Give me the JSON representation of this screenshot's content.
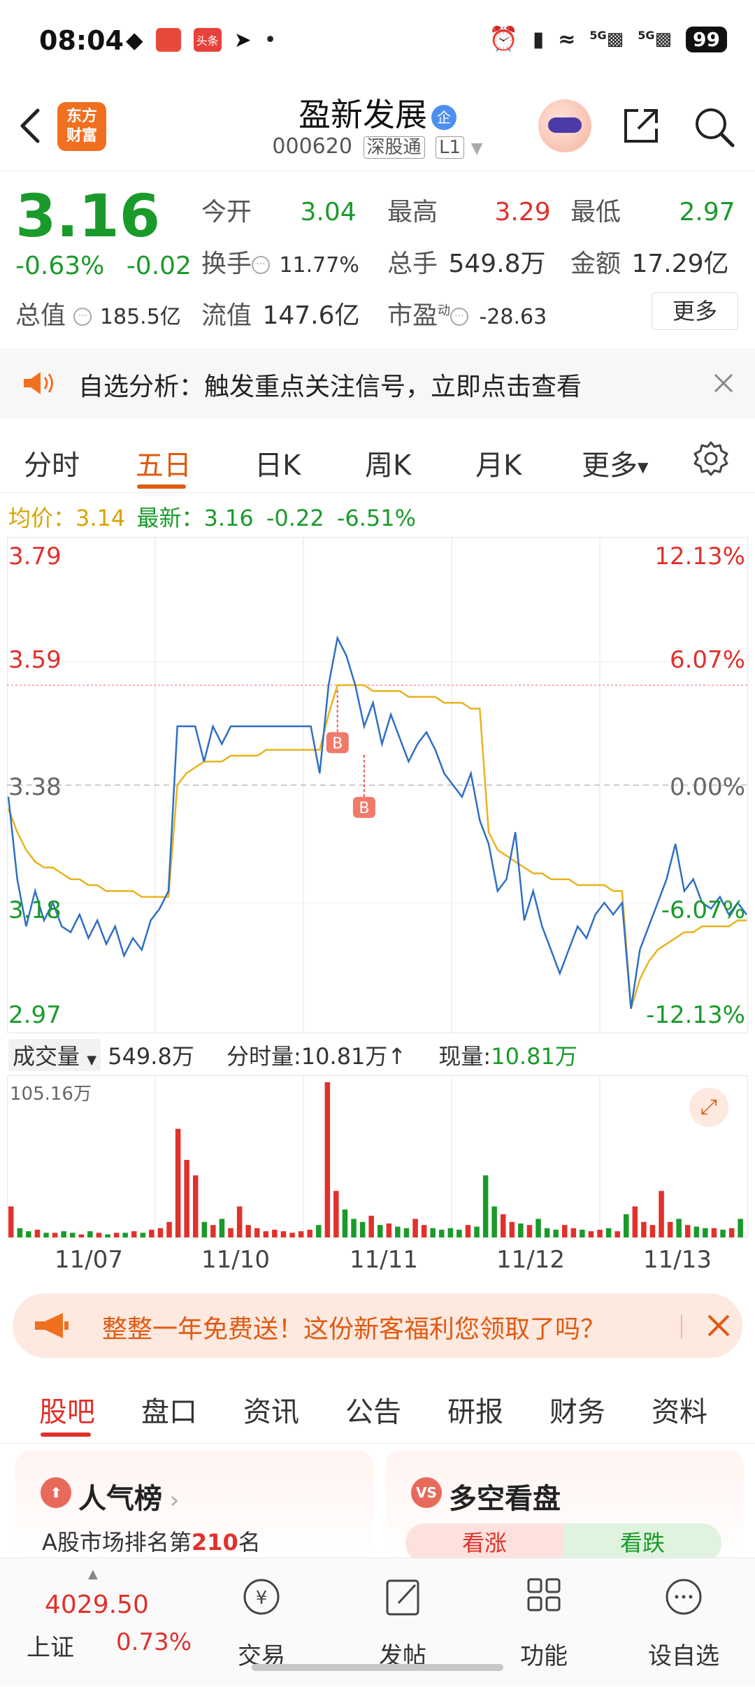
{
  "status_bar": {
    "time": "08:04",
    "battery": "99",
    "network_left": "5G",
    "network_right": "5G",
    "left_chips": [
      "wechat-icon",
      "app-icon",
      "头条",
      "paper-plane-icon",
      "•"
    ]
  },
  "header": {
    "stock_name": "盈新发展",
    "reg_badge": "企",
    "stock_code": "000620",
    "tag_connect": "深股通",
    "tag_level": "L1",
    "logo_line1": "东方",
    "logo_line2": "财富"
  },
  "quote": {
    "price": "3.16",
    "change_pct": "-0.63%",
    "change_abs": "-0.02",
    "market_cap_label": "总值",
    "market_cap": "185.5亿",
    "open_label": "今开",
    "open": "3.04",
    "high_label": "最高",
    "high": "3.29",
    "low_label": "最低",
    "low": "2.97",
    "turnover_label": "换手",
    "turnover": "11.77%",
    "volume_label": "总手",
    "volume": "549.8万",
    "amount_label": "金额",
    "amount": "17.29亿",
    "float_cap_label": "流值",
    "float_cap": "147.6亿",
    "pe_label": "市盈",
    "pe_super": "动",
    "pe": "-28.63",
    "more_label": "更多"
  },
  "alert": {
    "text": "自选分析：触发重点关注信号，立即点击查看"
  },
  "chart_tabs": {
    "items": [
      "分时",
      "五日",
      "日K",
      "周K",
      "月K",
      "更多"
    ],
    "active": "五日"
  },
  "avg_line": {
    "avg_label": "均价：",
    "avg_value": "3.14",
    "latest_label": "最新：",
    "latest_value": "3.16",
    "latest_chg": "-0.22",
    "latest_pct": "-6.51%"
  },
  "chart_data": {
    "type": "line",
    "title": "",
    "ylim": [
      2.97,
      3.79
    ],
    "y_ticks_left": [
      "3.79",
      "3.59",
      "3.38",
      "3.18",
      "2.97"
    ],
    "y_ticks_right": [
      "12.13%",
      "6.07%",
      "0.00%",
      "-6.07%",
      "-12.13%"
    ],
    "prev_close": 3.38,
    "days": [
      "11/07",
      "11/10",
      "11/11",
      "11/12",
      "11/13"
    ],
    "series": [
      {
        "name": "",
        "color": "#2f6fc4",
        "values": [
          3.36,
          3.22,
          3.14,
          3.2,
          3.15,
          3.18,
          3.14,
          3.13,
          3.16,
          3.12,
          3.15,
          3.11,
          3.14,
          3.09,
          3.12,
          3.1,
          3.15,
          3.17,
          3.2,
          3.48,
          3.48,
          3.48,
          3.42,
          3.48,
          3.45,
          3.48,
          3.48,
          3.48,
          3.48,
          3.48,
          3.48,
          3.48,
          3.48,
          3.48,
          3.48,
          3.4,
          3.55,
          3.63,
          3.6,
          3.55,
          3.48,
          3.52,
          3.45,
          3.5,
          3.46,
          3.42,
          3.45,
          3.47,
          3.44,
          3.4,
          3.38,
          3.36,
          3.4,
          3.32,
          3.28,
          3.2,
          3.22,
          3.3,
          3.15,
          3.2,
          3.14,
          3.1,
          3.06,
          3.1,
          3.14,
          3.12,
          3.16,
          3.18,
          3.16,
          3.18,
          3.0,
          3.1,
          3.14,
          3.18,
          3.22,
          3.28,
          3.2,
          3.22,
          3.18,
          3.17,
          3.19,
          3.16,
          3.18,
          3.16
        ]
      },
      {
        "name": "",
        "color": "#e7b31e",
        "values": [
          3.34,
          3.3,
          3.27,
          3.25,
          3.24,
          3.24,
          3.23,
          3.22,
          3.22,
          3.21,
          3.21,
          3.2,
          3.2,
          3.2,
          3.2,
          3.19,
          3.19,
          3.19,
          3.19,
          3.38,
          3.4,
          3.41,
          3.42,
          3.42,
          3.42,
          3.43,
          3.43,
          3.43,
          3.43,
          3.44,
          3.44,
          3.44,
          3.44,
          3.44,
          3.44,
          3.44,
          3.5,
          3.55,
          3.55,
          3.55,
          3.55,
          3.54,
          3.54,
          3.54,
          3.54,
          3.53,
          3.53,
          3.53,
          3.53,
          3.52,
          3.52,
          3.52,
          3.51,
          3.51,
          3.3,
          3.27,
          3.26,
          3.25,
          3.24,
          3.23,
          3.23,
          3.22,
          3.22,
          3.22,
          3.21,
          3.21,
          3.21,
          3.21,
          3.2,
          3.2,
          3.0,
          3.05,
          3.08,
          3.1,
          3.11,
          3.12,
          3.13,
          3.13,
          3.14,
          3.14,
          3.14,
          3.14,
          3.15,
          3.15
        ]
      }
    ],
    "trade_marks": [
      "B",
      "B"
    ],
    "volume_max_label": "105.16万",
    "volume": [
      20,
      6,
      4,
      5,
      3,
      3,
      4,
      3,
      2,
      4,
      3,
      2,
      3,
      3,
      4,
      3,
      5,
      6,
      10,
      70,
      50,
      40,
      10,
      8,
      12,
      6,
      20,
      8,
      6,
      4,
      5,
      4,
      3,
      4,
      5,
      8,
      100,
      30,
      18,
      12,
      10,
      14,
      8,
      9,
      7,
      6,
      12,
      8,
      6,
      5,
      6,
      5,
      8,
      7,
      40,
      20,
      15,
      10,
      9,
      8,
      12,
      6,
      5,
      8,
      6,
      5,
      4,
      5,
      6,
      4,
      15,
      20,
      10,
      8,
      30,
      10,
      12,
      8,
      7,
      6,
      6,
      5,
      6,
      12
    ]
  },
  "volume_head": {
    "label": "成交量",
    "total": "549.8万",
    "tick_label": "分时量:",
    "tick_value": "10.81万",
    "now_label": "现量:",
    "now_value": "10.81万"
  },
  "promo": {
    "text": "整整一年免费送！这份新客福利您领取了吗？"
  },
  "sub_tabs": {
    "items": [
      "股吧",
      "盘口",
      "资讯",
      "公告",
      "研报",
      "财务",
      "资料"
    ],
    "active": "股吧"
  },
  "cards": {
    "popularity": {
      "icon": "⬆",
      "title": "人气榜",
      "sub_prefix": "A股市场排名第",
      "rank": "210",
      "sub_suffix": "名"
    },
    "longshort": {
      "icon": "VS",
      "title": "多空看盘",
      "bull": "看涨",
      "bear": "看跌"
    }
  },
  "bottom_nav": {
    "index_value": "4029.50",
    "index_name": "上证",
    "index_chg": "0.73%",
    "items": [
      "交易",
      "发帖",
      "功能",
      "设自选"
    ]
  }
}
